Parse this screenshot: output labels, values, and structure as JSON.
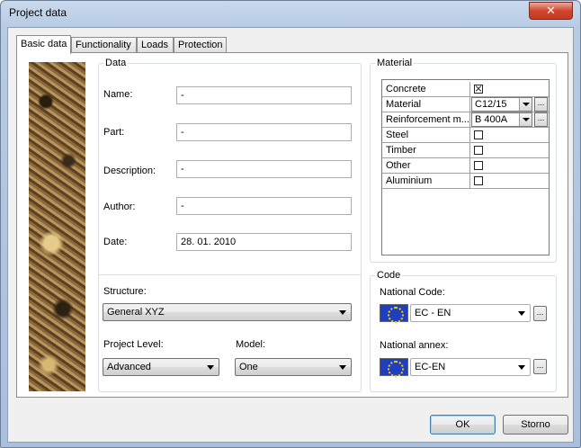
{
  "window": {
    "title": "Project data",
    "close_glyph": "✕"
  },
  "tabs": [
    {
      "label": "Basic data",
      "active": true
    },
    {
      "label": "Functionality",
      "active": false
    },
    {
      "label": "Loads",
      "active": false
    },
    {
      "label": "Protection",
      "active": false
    }
  ],
  "data_group": {
    "legend": "Data",
    "name_label": "Name:",
    "name_value": "-",
    "part_label": "Part:",
    "part_value": "-",
    "description_label": "Description:",
    "description_value": "-",
    "author_label": "Author:",
    "author_value": "-",
    "date_label": "Date:",
    "date_value": "28. 01. 2010",
    "structure_label": "Structure:",
    "structure_value": "General XYZ",
    "project_level_label": "Project Level:",
    "project_level_value": "Advanced",
    "model_label": "Model:",
    "model_value": "One"
  },
  "material_group": {
    "legend": "Material",
    "rows": [
      {
        "name": "Concrete",
        "checked": true
      },
      {
        "name": "Material",
        "value": "C12/15",
        "button": "..."
      },
      {
        "name": "Reinforcement m...",
        "value": "B 400A",
        "button": "..."
      },
      {
        "name": "Steel",
        "checked": false
      },
      {
        "name": "Timber",
        "checked": false
      },
      {
        "name": "Other",
        "checked": false
      },
      {
        "name": "Aluminium",
        "checked": false
      }
    ]
  },
  "code_group": {
    "legend": "Code",
    "national_code_label": "National Code:",
    "national_code_value": "EC - EN",
    "national_annex_label": "National annex:",
    "national_annex_value": "EC-EN",
    "browse_label": "..."
  },
  "buttons": {
    "ok": "OK",
    "cancel": "Storno"
  }
}
